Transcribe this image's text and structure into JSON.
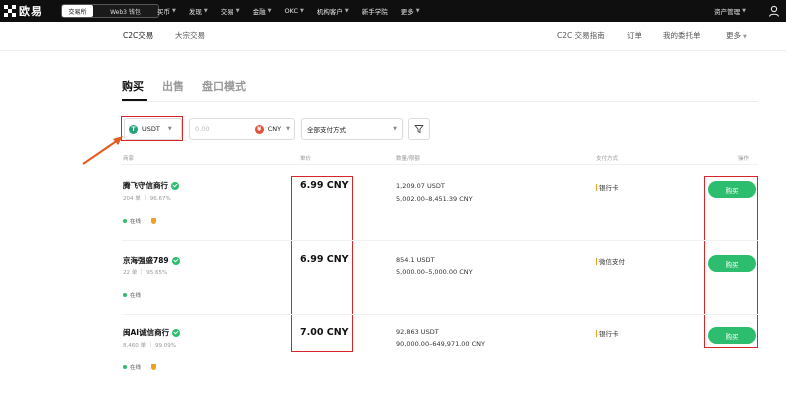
{
  "brand": {
    "name": "欧易"
  },
  "topnav": {
    "exchange_label": "交易所",
    "wallet_label": "Web3 钱包",
    "menu": [
      "买币",
      "发现",
      "交易",
      "金融",
      "OKC",
      "机构客户",
      "新手学院",
      "更多"
    ],
    "assets_label": "资产管理"
  },
  "subnav": {
    "c2c": "C2C交易",
    "bulk": "大宗交易",
    "guide": "C2C 交易指南",
    "orders": "订单",
    "my_ads": "我的委托单",
    "more": "更多"
  },
  "tabs": [
    "购买",
    "出售",
    "盘口模式"
  ],
  "filters": {
    "coin": "USDT",
    "amount_placeholder": "0.00",
    "fiat": "CNY",
    "payment": "全部支付方式"
  },
  "table": {
    "headers": [
      "商家",
      "单价",
      "数量/限额",
      "支付方式",
      "操作"
    ],
    "rows": [
      {
        "merchant": "腾飞守信商行",
        "stats": "204 单 ｜ 96.67%",
        "status": "在线",
        "price": "6.99 CNY",
        "quantity": "1,209.07 USDT",
        "limit": "5,002.00–8,451.39 CNY",
        "payment": "银行卡",
        "action": "购买"
      },
      {
        "merchant": "京海强盛789",
        "stats": "22 单 ｜ 95.65%",
        "status": "在线",
        "price": "6.99 CNY",
        "quantity": "854.1 USDT",
        "limit": "5,000.00–5,000.00 CNY",
        "payment": "微信支付",
        "action": "购买"
      },
      {
        "merchant": "闽AI诚信商行",
        "stats": "8,460 单 ｜ 99.09%",
        "status": "在线",
        "price": "7.00 CNY",
        "quantity": "92,863 USDT",
        "limit": "90,000.00–649,971.00 CNY",
        "payment": "银行卡",
        "action": "购买"
      }
    ]
  },
  "colors": {
    "accent_green": "#2dbd6e",
    "highlight_red": "#d6262a",
    "nav_bg": "#0f0f0f"
  }
}
